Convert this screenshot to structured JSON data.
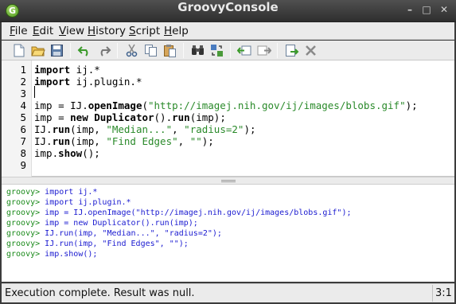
{
  "window": {
    "title": "GroovyConsole",
    "app_icon_letter": "G",
    "minimize_glyph": "–",
    "maximize_glyph": "□",
    "close_glyph": "✕"
  },
  "menu": {
    "items": [
      {
        "mnemonic": "F",
        "rest": "ile"
      },
      {
        "mnemonic": "E",
        "rest": "dit"
      },
      {
        "mnemonic": "V",
        "rest": "iew"
      },
      {
        "mnemonic": "H",
        "rest": "istory"
      },
      {
        "mnemonic": "S",
        "rest": "cript"
      },
      {
        "mnemonic": "H",
        "rest": "elp"
      }
    ]
  },
  "toolbar": {
    "icons": [
      "new-file-icon",
      "open-file-icon",
      "save-icon",
      "undo-icon",
      "redo-icon",
      "cut-icon",
      "copy-icon",
      "paste-icon",
      "find-icon",
      "replace-icon",
      "previous-history-icon",
      "next-history-icon",
      "run-script-icon",
      "interrupt-icon"
    ]
  },
  "editor": {
    "line_numbers": [
      "1",
      "2",
      "3",
      "4",
      "5",
      "6",
      "7",
      "8",
      "9"
    ],
    "lines": [
      [
        {
          "t": "import",
          "c": "kw"
        },
        {
          "t": " ij.*",
          "c": ""
        }
      ],
      [
        {
          "t": "import",
          "c": "kw"
        },
        {
          "t": " ij.plugin.*",
          "c": ""
        }
      ],
      [],
      [
        {
          "t": "imp = IJ.",
          "c": ""
        },
        {
          "t": "openImage",
          "c": "kw"
        },
        {
          "t": "(",
          "c": ""
        },
        {
          "t": "\"http://imagej.nih.gov/ij/images/blobs.gif\"",
          "c": "str"
        },
        {
          "t": ");",
          "c": ""
        }
      ],
      [
        {
          "t": "imp = ",
          "c": ""
        },
        {
          "t": "new",
          "c": "kw"
        },
        {
          "t": " ",
          "c": ""
        },
        {
          "t": "Duplicator",
          "c": "kw"
        },
        {
          "t": "().",
          "c": ""
        },
        {
          "t": "run",
          "c": "kw"
        },
        {
          "t": "(imp);",
          "c": ""
        }
      ],
      [
        {
          "t": "IJ.",
          "c": ""
        },
        {
          "t": "run",
          "c": "kw"
        },
        {
          "t": "(imp, ",
          "c": ""
        },
        {
          "t": "\"Median...\"",
          "c": "str"
        },
        {
          "t": ", ",
          "c": ""
        },
        {
          "t": "\"radius=2\"",
          "c": "str"
        },
        {
          "t": ");",
          "c": ""
        }
      ],
      [
        {
          "t": "IJ.",
          "c": ""
        },
        {
          "t": "run",
          "c": "kw"
        },
        {
          "t": "(imp, ",
          "c": ""
        },
        {
          "t": "\"Find Edges\"",
          "c": "str"
        },
        {
          "t": ", ",
          "c": ""
        },
        {
          "t": "\"\"",
          "c": "str"
        },
        {
          "t": ");",
          "c": ""
        }
      ],
      [
        {
          "t": "imp.",
          "c": ""
        },
        {
          "t": "show",
          "c": "kw"
        },
        {
          "t": "();",
          "c": ""
        }
      ],
      []
    ]
  },
  "output": {
    "prompt": "groovy> ",
    "lines": [
      "import ij.*",
      "import ij.plugin.*",
      "imp = IJ.openImage(\"http://imagej.nih.gov/ij/images/blobs.gif\");",
      "imp = new Duplicator().run(imp);",
      "IJ.run(imp, \"Median...\", \"radius=2\");",
      "IJ.run(imp, \"Find Edges\", \"\");",
      "imp.show();"
    ]
  },
  "status": {
    "message": "Execution complete. Result was null.",
    "caret_position": "3:1"
  },
  "colors": {
    "prompt": "#1a8a1a",
    "output_code": "#1a1ad0",
    "string_literal": "#2a8a2a",
    "app_icon": "#4f9a1e"
  }
}
